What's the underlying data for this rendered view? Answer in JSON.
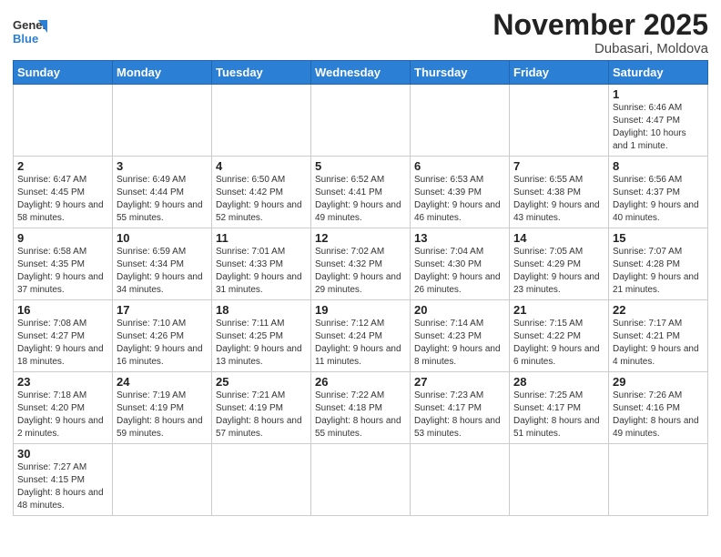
{
  "logo": {
    "general": "General",
    "blue": "Blue"
  },
  "header": {
    "month": "November 2025",
    "location": "Dubasari, Moldova"
  },
  "weekdays": [
    "Sunday",
    "Monday",
    "Tuesday",
    "Wednesday",
    "Thursday",
    "Friday",
    "Saturday"
  ],
  "days": {
    "1": {
      "sunrise": "6:46 AM",
      "sunset": "4:47 PM",
      "daylight": "10 hours and 1 minute."
    },
    "2": {
      "sunrise": "6:47 AM",
      "sunset": "4:45 PM",
      "daylight": "9 hours and 58 minutes."
    },
    "3": {
      "sunrise": "6:49 AM",
      "sunset": "4:44 PM",
      "daylight": "9 hours and 55 minutes."
    },
    "4": {
      "sunrise": "6:50 AM",
      "sunset": "4:42 PM",
      "daylight": "9 hours and 52 minutes."
    },
    "5": {
      "sunrise": "6:52 AM",
      "sunset": "4:41 PM",
      "daylight": "9 hours and 49 minutes."
    },
    "6": {
      "sunrise": "6:53 AM",
      "sunset": "4:39 PM",
      "daylight": "9 hours and 46 minutes."
    },
    "7": {
      "sunrise": "6:55 AM",
      "sunset": "4:38 PM",
      "daylight": "9 hours and 43 minutes."
    },
    "8": {
      "sunrise": "6:56 AM",
      "sunset": "4:37 PM",
      "daylight": "9 hours and 40 minutes."
    },
    "9": {
      "sunrise": "6:58 AM",
      "sunset": "4:35 PM",
      "daylight": "9 hours and 37 minutes."
    },
    "10": {
      "sunrise": "6:59 AM",
      "sunset": "4:34 PM",
      "daylight": "9 hours and 34 minutes."
    },
    "11": {
      "sunrise": "7:01 AM",
      "sunset": "4:33 PM",
      "daylight": "9 hours and 31 minutes."
    },
    "12": {
      "sunrise": "7:02 AM",
      "sunset": "4:32 PM",
      "daylight": "9 hours and 29 minutes."
    },
    "13": {
      "sunrise": "7:04 AM",
      "sunset": "4:30 PM",
      "daylight": "9 hours and 26 minutes."
    },
    "14": {
      "sunrise": "7:05 AM",
      "sunset": "4:29 PM",
      "daylight": "9 hours and 23 minutes."
    },
    "15": {
      "sunrise": "7:07 AM",
      "sunset": "4:28 PM",
      "daylight": "9 hours and 21 minutes."
    },
    "16": {
      "sunrise": "7:08 AM",
      "sunset": "4:27 PM",
      "daylight": "9 hours and 18 minutes."
    },
    "17": {
      "sunrise": "7:10 AM",
      "sunset": "4:26 PM",
      "daylight": "9 hours and 16 minutes."
    },
    "18": {
      "sunrise": "7:11 AM",
      "sunset": "4:25 PM",
      "daylight": "9 hours and 13 minutes."
    },
    "19": {
      "sunrise": "7:12 AM",
      "sunset": "4:24 PM",
      "daylight": "9 hours and 11 minutes."
    },
    "20": {
      "sunrise": "7:14 AM",
      "sunset": "4:23 PM",
      "daylight": "9 hours and 8 minutes."
    },
    "21": {
      "sunrise": "7:15 AM",
      "sunset": "4:22 PM",
      "daylight": "9 hours and 6 minutes."
    },
    "22": {
      "sunrise": "7:17 AM",
      "sunset": "4:21 PM",
      "daylight": "9 hours and 4 minutes."
    },
    "23": {
      "sunrise": "7:18 AM",
      "sunset": "4:20 PM",
      "daylight": "9 hours and 2 minutes."
    },
    "24": {
      "sunrise": "7:19 AM",
      "sunset": "4:19 PM",
      "daylight": "8 hours and 59 minutes."
    },
    "25": {
      "sunrise": "7:21 AM",
      "sunset": "4:19 PM",
      "daylight": "8 hours and 57 minutes."
    },
    "26": {
      "sunrise": "7:22 AM",
      "sunset": "4:18 PM",
      "daylight": "8 hours and 55 minutes."
    },
    "27": {
      "sunrise": "7:23 AM",
      "sunset": "4:17 PM",
      "daylight": "8 hours and 53 minutes."
    },
    "28": {
      "sunrise": "7:25 AM",
      "sunset": "4:17 PM",
      "daylight": "8 hours and 51 minutes."
    },
    "29": {
      "sunrise": "7:26 AM",
      "sunset": "4:16 PM",
      "daylight": "8 hours and 49 minutes."
    },
    "30": {
      "sunrise": "7:27 AM",
      "sunset": "4:15 PM",
      "daylight": "8 hours and 48 minutes."
    }
  }
}
